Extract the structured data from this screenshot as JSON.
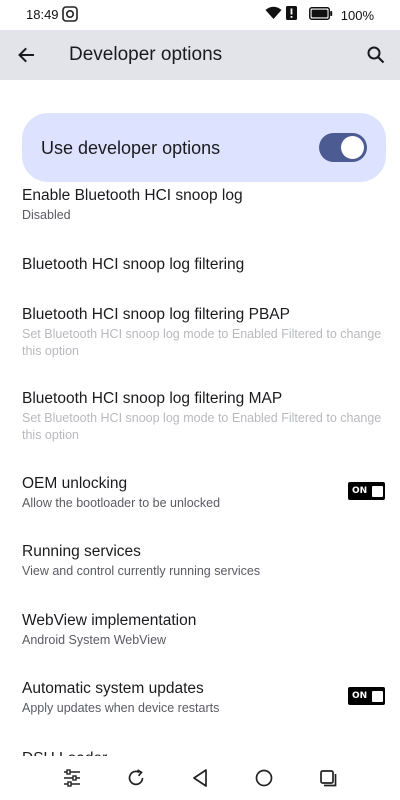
{
  "status_bar": {
    "time": "18:49",
    "battery_percent": "100%"
  },
  "app_bar": {
    "title": "Developer options"
  },
  "master_toggle": {
    "label": "Use developer options",
    "on": true
  },
  "settings": [
    {
      "title": "Enable Bluetooth HCI snoop log",
      "summary": "Disabled"
    },
    {
      "title": "Bluetooth HCI snoop log filtering",
      "summary": ""
    },
    {
      "title": "Bluetooth HCI snoop log filtering PBAP",
      "summary": "Set Bluetooth HCI snoop log mode to Enabled Filtered to change this option"
    },
    {
      "title": "Bluetooth HCI snoop log filtering MAP",
      "summary": "Set Bluetooth HCI snoop log mode to Enabled Filtered to change this option"
    },
    {
      "title": "OEM unlocking",
      "summary": "Allow the bootloader to be unlocked",
      "switch_label": "ON"
    },
    {
      "title": "Running services",
      "summary": "View and control currently running services"
    },
    {
      "title": "WebView implementation",
      "summary": "Android System WebView"
    },
    {
      "title": "Automatic system updates",
      "summary": "Apply updates when device restarts",
      "switch_label": "ON"
    }
  ],
  "partial_item": "DSU Loader",
  "colors": {
    "app_bar_bg": "#e3e4ea",
    "master_card_bg": "#dde3ff",
    "switch_track": "#4c5b91"
  },
  "icons": {
    "back": "arrow-left-icon",
    "search": "search-icon",
    "nav": [
      "sliders-icon",
      "rotate-icon",
      "back-triangle-icon",
      "home-circle-icon",
      "recents-square-icon"
    ]
  }
}
